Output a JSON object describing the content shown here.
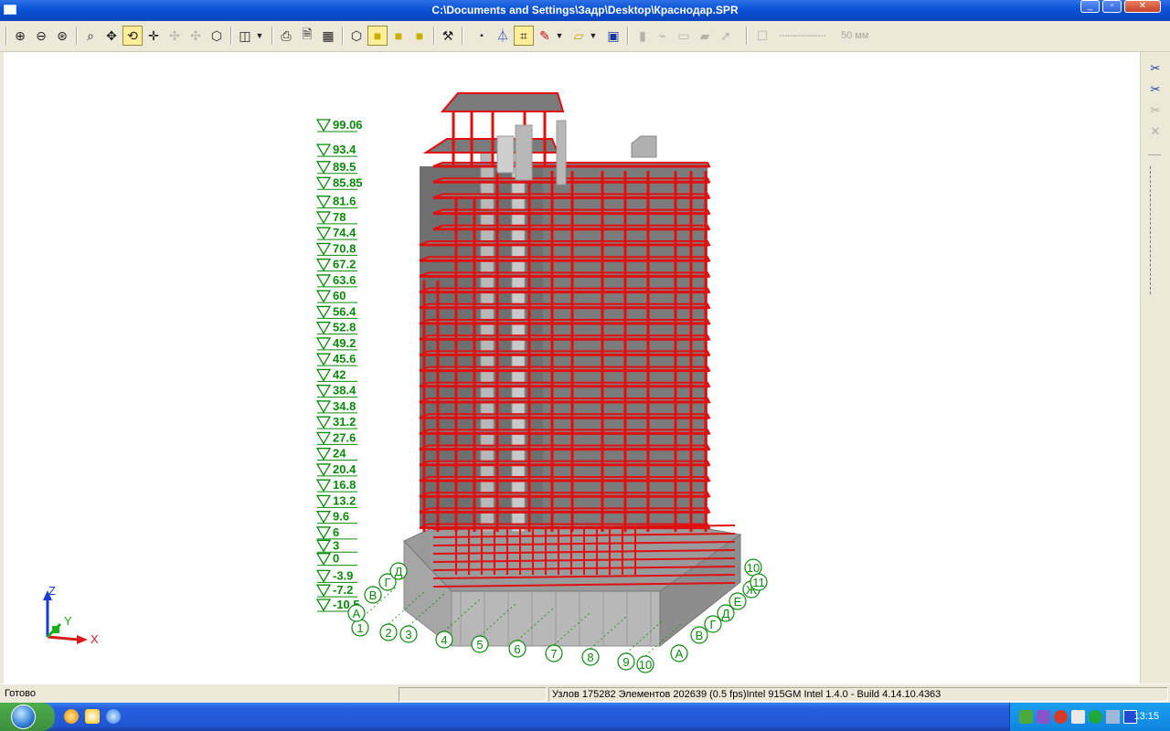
{
  "window": {
    "title": "C:\\Documents and Settings\\Задр\\Desktop\\Краснодар.SPR"
  },
  "toolbar": {
    "line_width_label": "50 мм"
  },
  "elevations": [
    "99.06",
    "93.4",
    "89.5",
    "85.85",
    "81.6",
    "78",
    "74.4",
    "70.8",
    "67.2",
    "63.6",
    "60",
    "56.4",
    "52.8",
    "49.2",
    "45.6",
    "42",
    "38.4",
    "34.8",
    "31.2",
    "27.6",
    "24",
    "20.4",
    "16.8",
    "13.2",
    "9.6",
    "6",
    "3",
    "0",
    "-3.9",
    "-7.2",
    "-10.5"
  ],
  "grid_axes_numbers": [
    "1",
    "2",
    "3",
    "4",
    "5",
    "6",
    "7",
    "8",
    "9",
    "10"
  ],
  "grid_axes_letters_left": [
    "А",
    "В",
    "Г",
    "Д"
  ],
  "grid_axes_letters_right": [
    "А",
    "В",
    "Г",
    "Д",
    "Е",
    "Ж",
    "10",
    "11"
  ],
  "triad": {
    "z": "Z",
    "y": "Y",
    "x": "X"
  },
  "status": {
    "ready": "Готово",
    "info": "Узлов 175282  Элементов 202639  (0.5 fps)Intel 915GM Intel 1.4.0 - Build 4.14.10.4363"
  },
  "taskbar": {
    "clock": "13:15"
  },
  "colors": {
    "frame": "#e01010",
    "slab": "#808080",
    "wall": "#b8b8b8",
    "label_green": "#0a8a0a"
  }
}
